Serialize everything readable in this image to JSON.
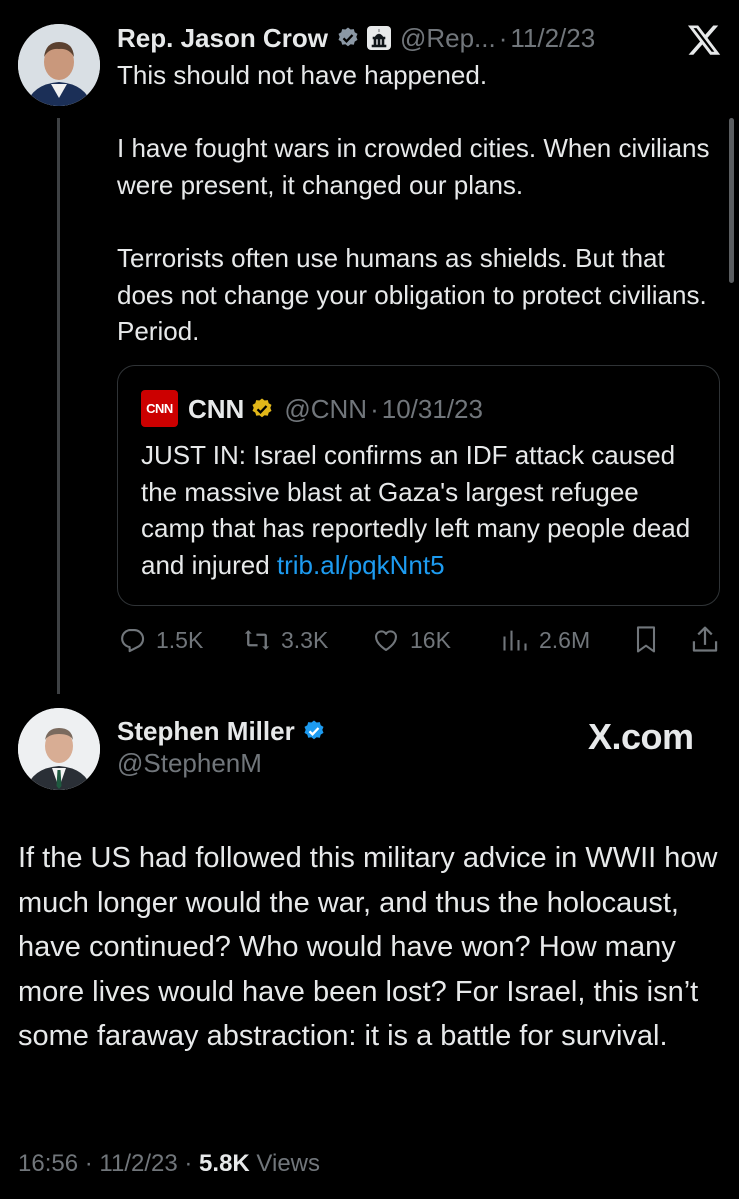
{
  "top_tweet": {
    "author_name": "Rep. Jason Crow",
    "handle": "@Rep...",
    "separator": "·",
    "date": "11/2/23",
    "paragraphs": [
      "This should not have happened.",
      "I have fought wars in crowded cities. When civilians were present, it changed our plans.",
      "Terrorists often use humans as shields. But that does not change your obligation to protect civilians. Period."
    ],
    "quote": {
      "logo_text": "CNN",
      "author_name": "CNN",
      "handle": "@CNN",
      "separator": "·",
      "date": "10/31/23",
      "text": "JUST IN: Israel confirms an IDF attack caused the massive blast at Gaza's largest refugee camp that has reportedly left many people dead and injured ",
      "link": "trib.al/pqkNnt5"
    },
    "actions": {
      "replies": "1.5K",
      "reposts": "3.3K",
      "likes": "16K",
      "views": "2.6M"
    }
  },
  "reply_tweet": {
    "author_name": "Stephen Miller",
    "handle": "@StephenM",
    "watermark": "X.com",
    "text": "If the US had followed this military advice in WWII how much longer would the war, and thus the holocaust, have continued? Who would have won? How many more lives would have been lost? For Israel, this isn’t some faraway abstraction: it is a battle for survival.",
    "time": "16:56",
    "date": "11/2/23",
    "separator": "·",
    "views_count": "5.8K",
    "views_label": "Views"
  },
  "colors": {
    "background": "#000000",
    "text": "#e7e9ea",
    "secondary": "#71767b",
    "link": "#1d9bf0",
    "verified_blue": "#1d9bf0",
    "verified_gold": "#e2b719",
    "cnn_red": "#cc0000"
  },
  "icons": [
    "verified-badge-icon",
    "government-badge-icon",
    "x-logo-icon",
    "reply-icon",
    "repost-icon",
    "like-icon",
    "views-icon",
    "bookmark-icon",
    "share-icon"
  ]
}
